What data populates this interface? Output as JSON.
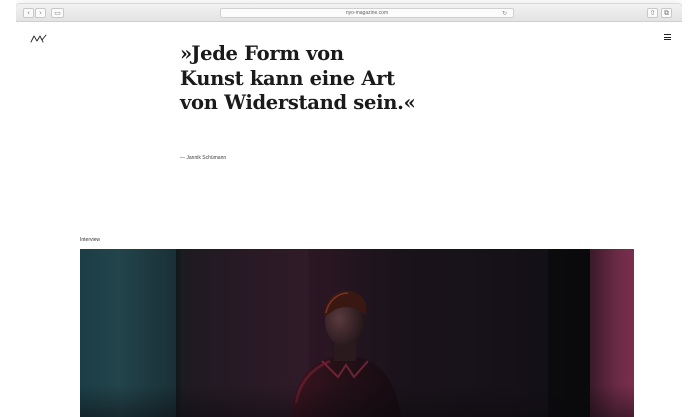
{
  "browser": {
    "url": "nyo-magazine.com",
    "back_icon": "‹",
    "forward_icon": "›",
    "sidebar_icon": "▭",
    "reload_icon": "↻",
    "share_icon": "⇧",
    "tabs_icon": "⧉"
  },
  "site": {
    "logo_icon": "nyo-logo-icon",
    "menu_icon": "hamburger-menu-icon"
  },
  "article": {
    "quote_line1": "»Jede Form von",
    "quote_line2": "Kunst kann eine Art",
    "quote_line3": "von Widerstand sein.«",
    "author": "— Jannik Schümann",
    "section": "Interview"
  },
  "photo": {
    "subject": "portrait-photo"
  },
  "colors": {
    "text": "#1a1a1a",
    "page_bg": "#ffffff",
    "toolbar_bg": "#e8e8e8"
  }
}
